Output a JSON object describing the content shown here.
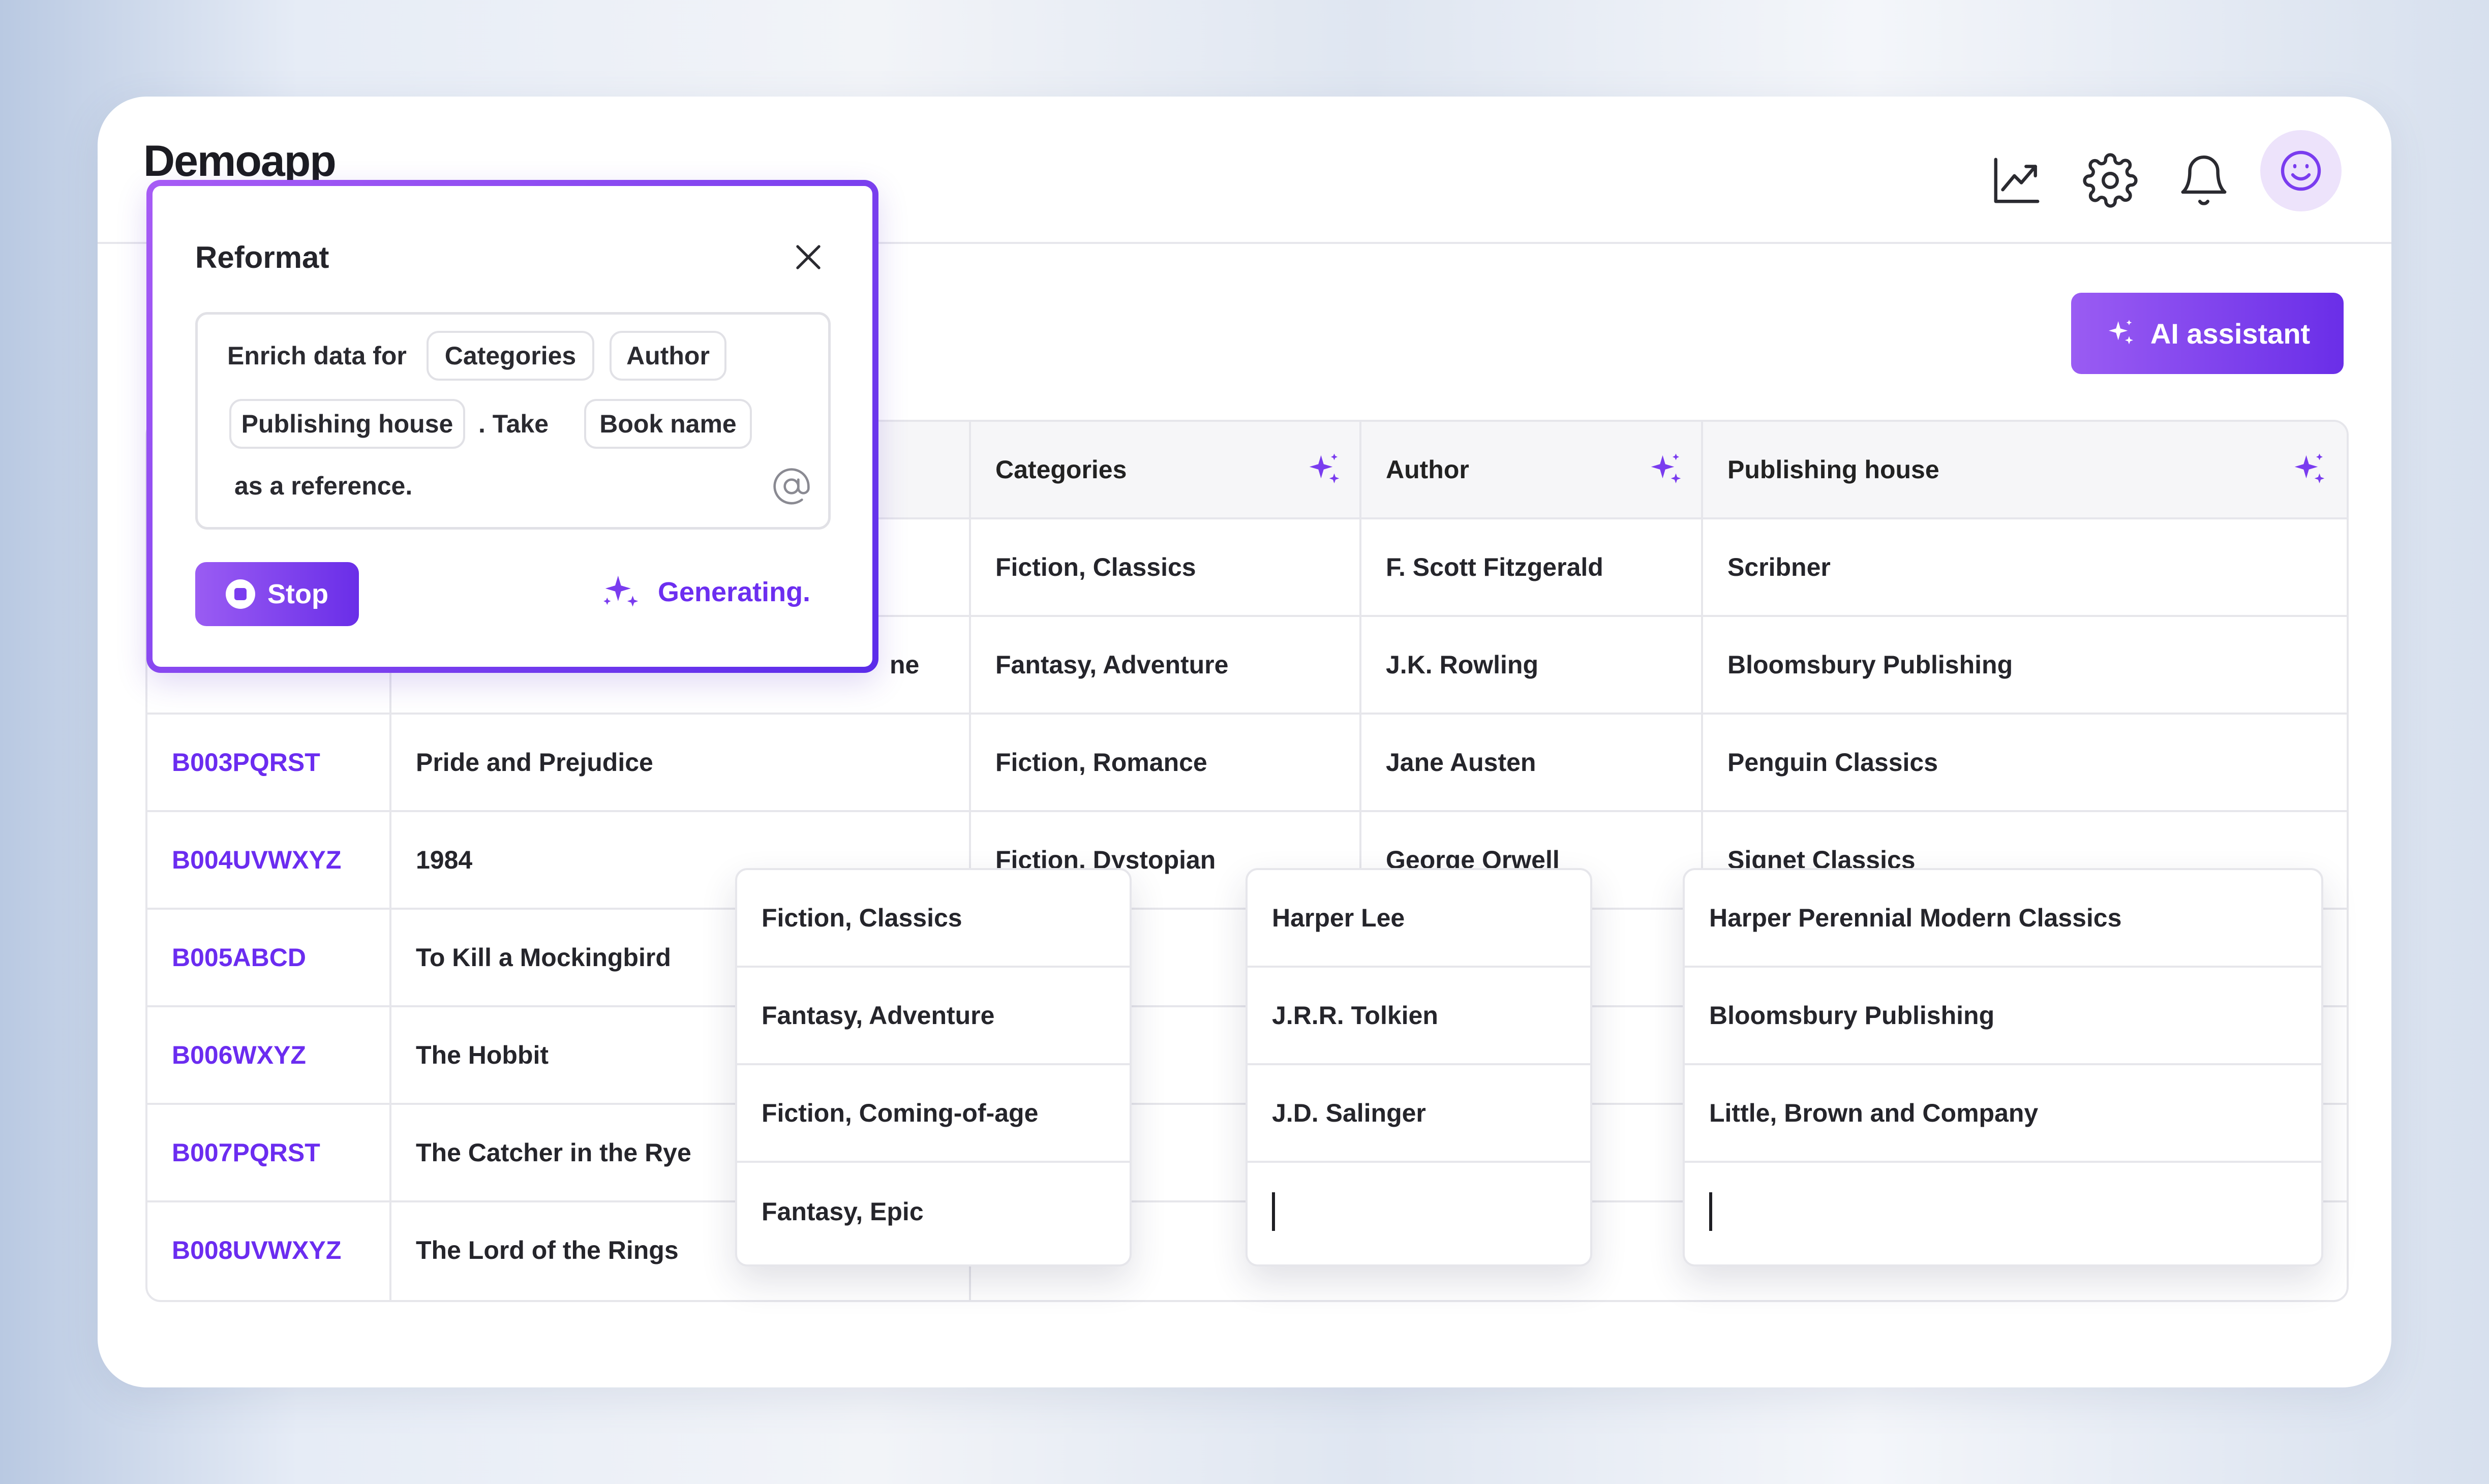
{
  "app": {
    "title": "Demoapp"
  },
  "header": {
    "icons": [
      "chart-icon",
      "settings-icon",
      "bell-icon",
      "smiley-avatar-icon"
    ]
  },
  "ai_button": {
    "label": "AI assistant"
  },
  "table": {
    "headers": [
      "Categories",
      "Author",
      "Publishing house"
    ],
    "rows": [
      {
        "categories": "Fiction, Classics",
        "author": "F. Scott Fitzgerald",
        "publisher": "Scribner"
      },
      {
        "title_fragment": "ne",
        "categories": "Fantasy, Adventure",
        "author": "J.K. Rowling",
        "publisher": "Bloomsbury Publishing"
      },
      {
        "id": "B003PQRST",
        "title": "Pride and Prejudice",
        "categories": "Fiction, Romance",
        "author": "Jane Austen",
        "publisher": "Penguin Classics"
      },
      {
        "id": "B004UVWXYZ",
        "title": "1984",
        "categories": "Fiction, Dystopian",
        "author": "George Orwell",
        "publisher": "Signet Classics"
      },
      {
        "id": "B005ABCD",
        "title": "To Kill a Mockingbird"
      },
      {
        "id": "B006WXYZ",
        "title": "The Hobbit"
      },
      {
        "id": "B007PQRST",
        "title": "The Catcher in the Rye"
      },
      {
        "id": "B008UVWXYZ",
        "title": "The Lord of the Rings"
      }
    ]
  },
  "dropdowns": {
    "categories": [
      "Fiction, Classics",
      "Fantasy, Adventure",
      "Fiction, Coming-of-age",
      "Fantasy, Epic"
    ],
    "authors": [
      "Harper Lee",
      "J.R.R. Tolkien",
      "J.D. Salinger"
    ],
    "publishers": [
      "Harper Perennial Modern Classics",
      "Bloomsbury Publishing",
      "Little, Brown and Company"
    ]
  },
  "reformat_panel": {
    "title": "Reformat",
    "prompt": {
      "prefix": "Enrich data for",
      "chips": [
        "Categories",
        "Author",
        "Publishing house",
        "Book name"
      ],
      "dot_take": ". Take",
      "suffix": "as a reference."
    },
    "stop_label": "Stop",
    "status": "Generating."
  },
  "colors": {
    "accent": "#6b2cf0",
    "accent_light": "#9a5cf3"
  }
}
